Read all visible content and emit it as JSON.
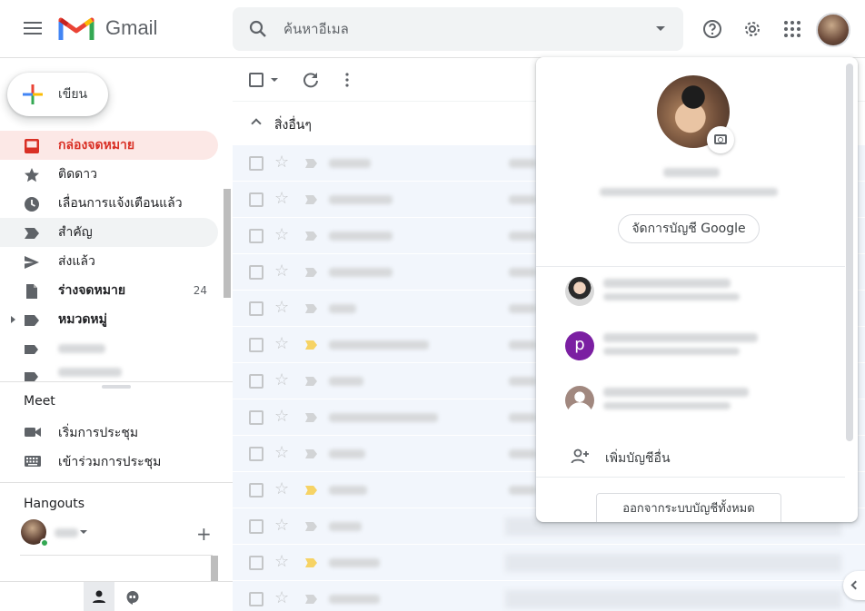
{
  "app": {
    "name": "Gmail"
  },
  "colors": {
    "accent": "#d93025",
    "active_bg": "#fce8e6",
    "online": "#34a853",
    "avatar_p": "#7b1fa2"
  },
  "search": {
    "placeholder": "ค้นหาอีเมล"
  },
  "compose": {
    "label": "เขียน"
  },
  "sidebar": {
    "items": [
      {
        "label": "กล่องจดหมาย",
        "icon": "inbox-icon"
      },
      {
        "label": "ติดดาว",
        "icon": "star-icon"
      },
      {
        "label": "เลื่อนการแจ้งเตือนแล้ว",
        "icon": "clock-icon"
      },
      {
        "label": "สำคัญ",
        "icon": "label-important-icon"
      },
      {
        "label": "ส่งแล้ว",
        "icon": "send-icon"
      },
      {
        "label": "ร่างจดหมาย",
        "icon": "draft-icon",
        "count": "24"
      },
      {
        "label": "หมวดหมู่",
        "icon": "label-icon"
      }
    ]
  },
  "meet": {
    "title": "Meet",
    "items": [
      {
        "label": "เริ่มการประชุม",
        "icon": "video-camera-icon"
      },
      {
        "label": "เข้าร่วมการประชุม",
        "icon": "keyboard-icon"
      }
    ]
  },
  "hangouts": {
    "title": "Hangouts"
  },
  "main": {
    "section_label": "สิ่งอื่นๆ"
  },
  "popup": {
    "manage_label": "จัดการบัญชี Google",
    "add_account_label": "เพิ่มบัญชีอื่น",
    "signout_label": "ออกจากระบบบัญชีทั้งหมด",
    "second_account_initial": "p"
  }
}
